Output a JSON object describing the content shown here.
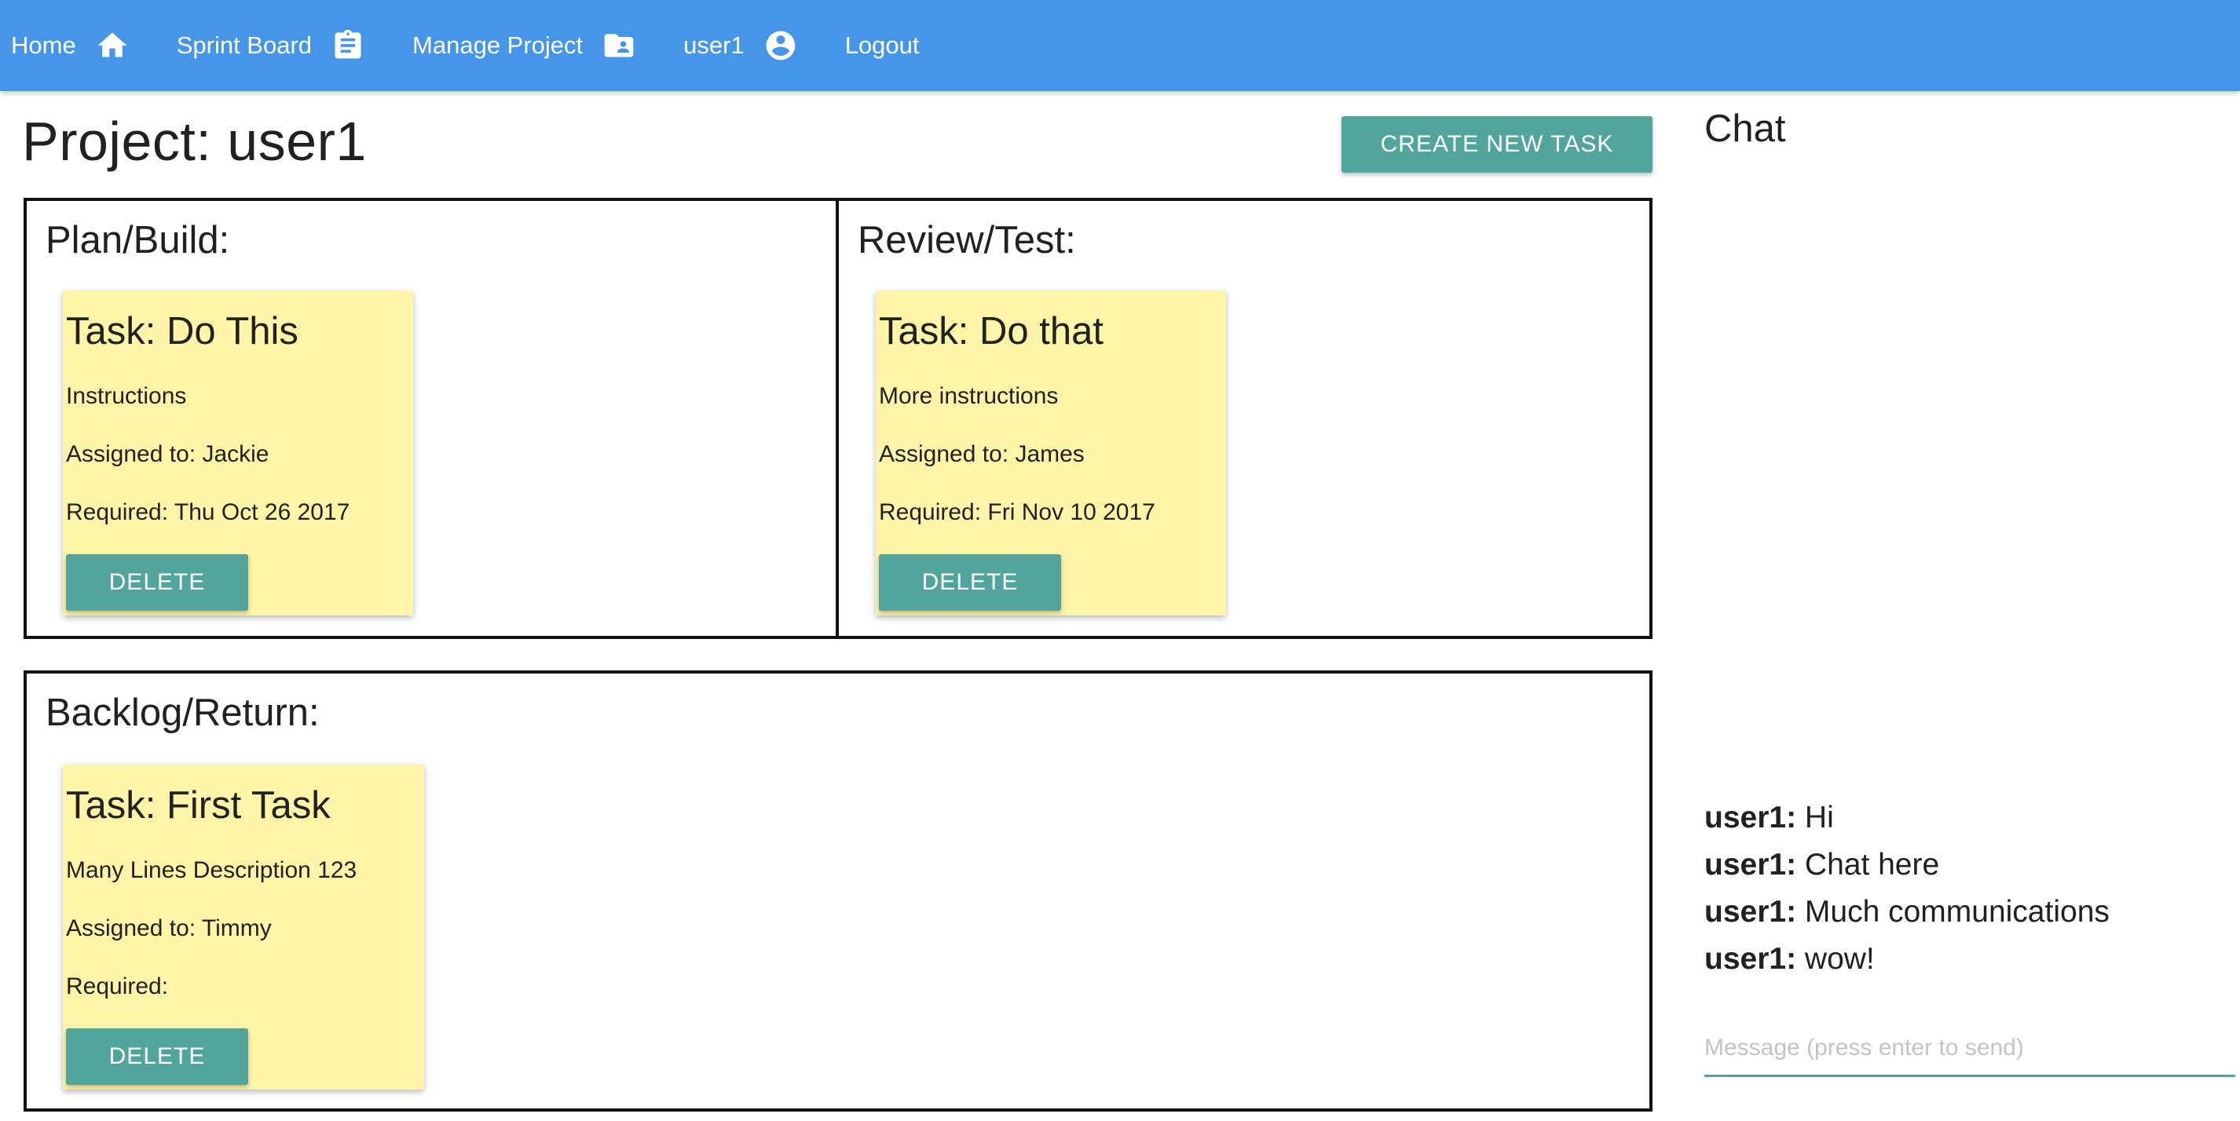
{
  "nav": {
    "home": "Home",
    "sprint_board": "Sprint Board",
    "manage_project": "Manage Project",
    "user": "user1",
    "logout": "Logout"
  },
  "page": {
    "title": "Project: user1",
    "create_button": "CREATE NEW TASK"
  },
  "lanes": {
    "plan": {
      "title": "Plan/Build:",
      "tasks": [
        {
          "title": "Task: Do This",
          "description": "Instructions",
          "assigned": "Assigned to: Jackie",
          "required": "Required: Thu Oct 26 2017",
          "delete_label": "DELETE"
        }
      ]
    },
    "review": {
      "title": "Review/Test:",
      "tasks": [
        {
          "title": "Task: Do that",
          "description": "More instructions",
          "assigned": "Assigned to: James",
          "required": "Required: Fri Nov 10 2017",
          "delete_label": "DELETE"
        }
      ]
    },
    "backlog": {
      "title": "Backlog/Return:",
      "tasks": [
        {
          "title": "Task: First Task",
          "description": "Many Lines Description 123",
          "assigned": "Assigned to: Timmy",
          "required": "Required:",
          "delete_label": "DELETE"
        }
      ]
    }
  },
  "chat": {
    "title": "Chat",
    "messages": [
      {
        "user": "user1:",
        "text": " Hi"
      },
      {
        "user": "user1:",
        "text": " Chat here"
      },
      {
        "user": "user1:",
        "text": " Much communications"
      },
      {
        "user": "user1:",
        "text": " wow!"
      }
    ],
    "input_placeholder": "Message (press enter to send)"
  },
  "colors": {
    "navbar": "#4595e9",
    "button": "#52a59a",
    "card": "#fff4a8"
  },
  "icons": {
    "home": "home-icon",
    "sprint_board": "clipboard-icon",
    "manage_project": "folder-account-icon",
    "user": "account-circle-icon"
  }
}
